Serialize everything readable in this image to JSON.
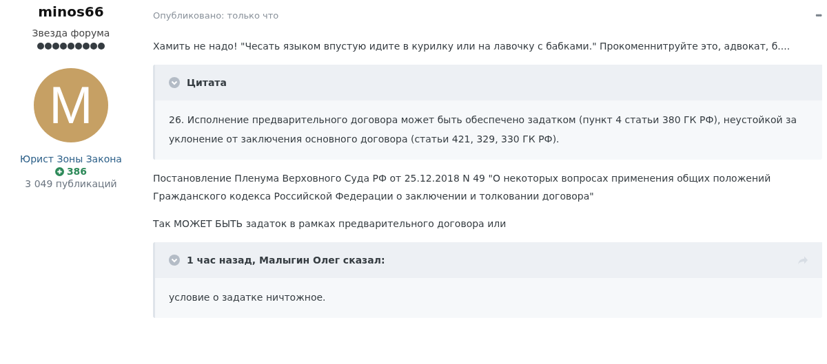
{
  "author": {
    "name": "minos66",
    "rank": "Звезда форума",
    "stars": 9,
    "avatar_letter": "M",
    "group": "Юрист Зоны Закона",
    "reputation": "386",
    "posts": "3 049 публикаций"
  },
  "post": {
    "published": "Опубликовано: только что",
    "menu": "•••",
    "content": [
      {
        "kind": "paragraph",
        "text": "Хамить не надо! \"Чесать языком впустую идите в курилку или на лавочку с бабками.\" Прокоменнитруйте это, адвокат, б...."
      },
      {
        "kind": "quote",
        "title": "Цитата",
        "share": false,
        "text": "26. Исполнение предварительного договора может быть обеспечено задатком (пункт 4 статьи 380 ГК РФ), неустойкой за уклонение от заключения основного договора (статьи 421, 329, 330 ГК РФ)."
      },
      {
        "kind": "paragraph",
        "text": "Постановление Пленума Верховного Суда РФ от 25.12.2018 N 49 \"О некоторых вопросах применения общих положений Гражданского кодекса Российской Федерации о заключении и толковании договора\""
      },
      {
        "kind": "paragraph",
        "text": "Так МОЖЕТ БЫТЬ задаток в рамках предварительного договора или"
      },
      {
        "kind": "quote",
        "title": "1 час назад, Малыгин Олег сказал:",
        "share": true,
        "text": "условие о задатке ничтожное."
      }
    ]
  }
}
